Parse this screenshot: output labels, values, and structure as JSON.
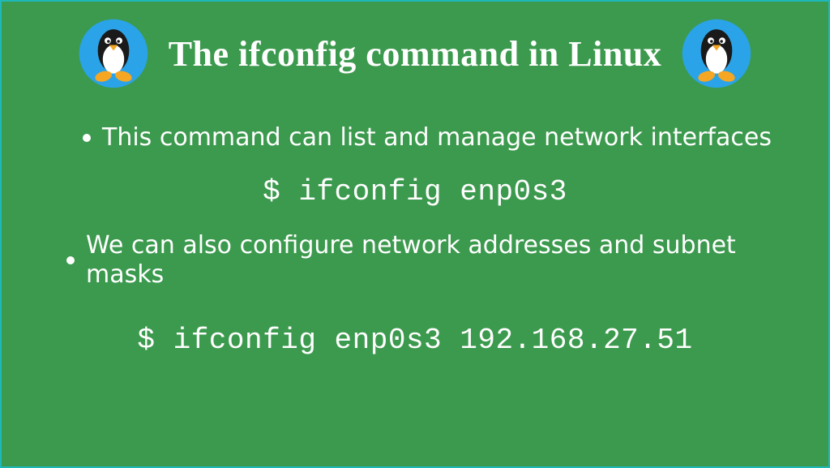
{
  "title": "The ifconfig command in Linux",
  "bullets": [
    "This command can list and manage network interfaces",
    "We can also configure network addresses and subnet masks"
  ],
  "commands": [
    "$ ifconfig enp0s3",
    "$ ifconfig enp0s3 192.168.27.51"
  ],
  "icon_name": "tux-icon",
  "colors": {
    "background": "#3c9a4e",
    "border": "#1fb8b8",
    "text": "#ffffff",
    "badge_bg": "#2aa3e8"
  }
}
